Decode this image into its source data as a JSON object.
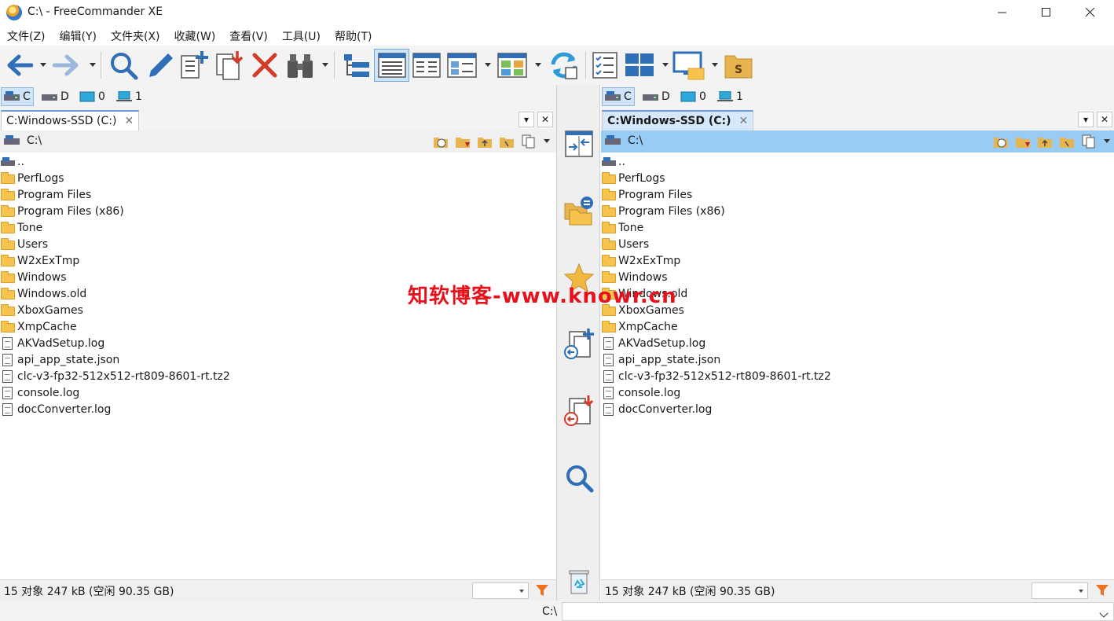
{
  "window": {
    "title": "C:\\ - FreeCommander XE"
  },
  "menu": [
    "文件(Z)",
    "编辑(Y)",
    "文件夹(X)",
    "收藏(W)",
    "查看(V)",
    "工具(U)",
    "帮助(T)"
  ],
  "toolbar": {
    "icons": [
      "back-arrow-icon",
      "forward-arrow-icon",
      "search-icon",
      "edit-pencil-icon",
      "new-file-icon",
      "copy-to-icon",
      "delete-icon",
      "binoculars-icon",
      "tree-view-icon",
      "details-view-icon",
      "list-view-icon",
      "brief-view-icon",
      "thumbnail-view-icon",
      "sync-icon",
      "checklist-icon",
      "layout-icon",
      "monitor-icon",
      "s-drive-icon"
    ]
  },
  "drives": [
    {
      "label": "C",
      "selected": true
    },
    {
      "label": "D",
      "selected": false
    },
    {
      "label": "0",
      "selected": false
    },
    {
      "label": "1",
      "selected": false
    }
  ],
  "left_panel": {
    "tab": "C:Windows-SSD (C:)",
    "path": "C:\\",
    "status": "15 对象   247 kB  (空闲 90.35 GB)"
  },
  "right_panel": {
    "tab": "C:Windows-SSD (C:)",
    "path": "C:\\",
    "status": "15 对象   247 kB  (空闲 90.35 GB)"
  },
  "files": [
    {
      "name": "..",
      "type": "up"
    },
    {
      "name": "PerfLogs",
      "type": "folder"
    },
    {
      "name": "Program Files",
      "type": "folder"
    },
    {
      "name": "Program Files (x86)",
      "type": "folder"
    },
    {
      "name": "Tone",
      "type": "folder"
    },
    {
      "name": "Users",
      "type": "folder"
    },
    {
      "name": "W2xExTmp",
      "type": "folder"
    },
    {
      "name": "Windows",
      "type": "folder"
    },
    {
      "name": "Windows.old",
      "type": "folder"
    },
    {
      "name": "XboxGames",
      "type": "folder"
    },
    {
      "name": "XmpCache",
      "type": "folder"
    },
    {
      "name": "AKVadSetup.log",
      "type": "file"
    },
    {
      "name": "api_app_state.json",
      "type": "file"
    },
    {
      "name": "clc-v3-fp32-512x512-rt809-8601-rt.tz2",
      "type": "file"
    },
    {
      "name": "console.log",
      "type": "file"
    },
    {
      "name": "docConverter.log",
      "type": "file"
    }
  ],
  "command_line": {
    "label": "C:\\"
  },
  "watermark": "知软博客-www.knowr.cn",
  "colors": {
    "accent": "#2f6fb8",
    "active_path": "#99ccf5",
    "folder": "#f6c44c",
    "watermark": "#e8101a"
  }
}
